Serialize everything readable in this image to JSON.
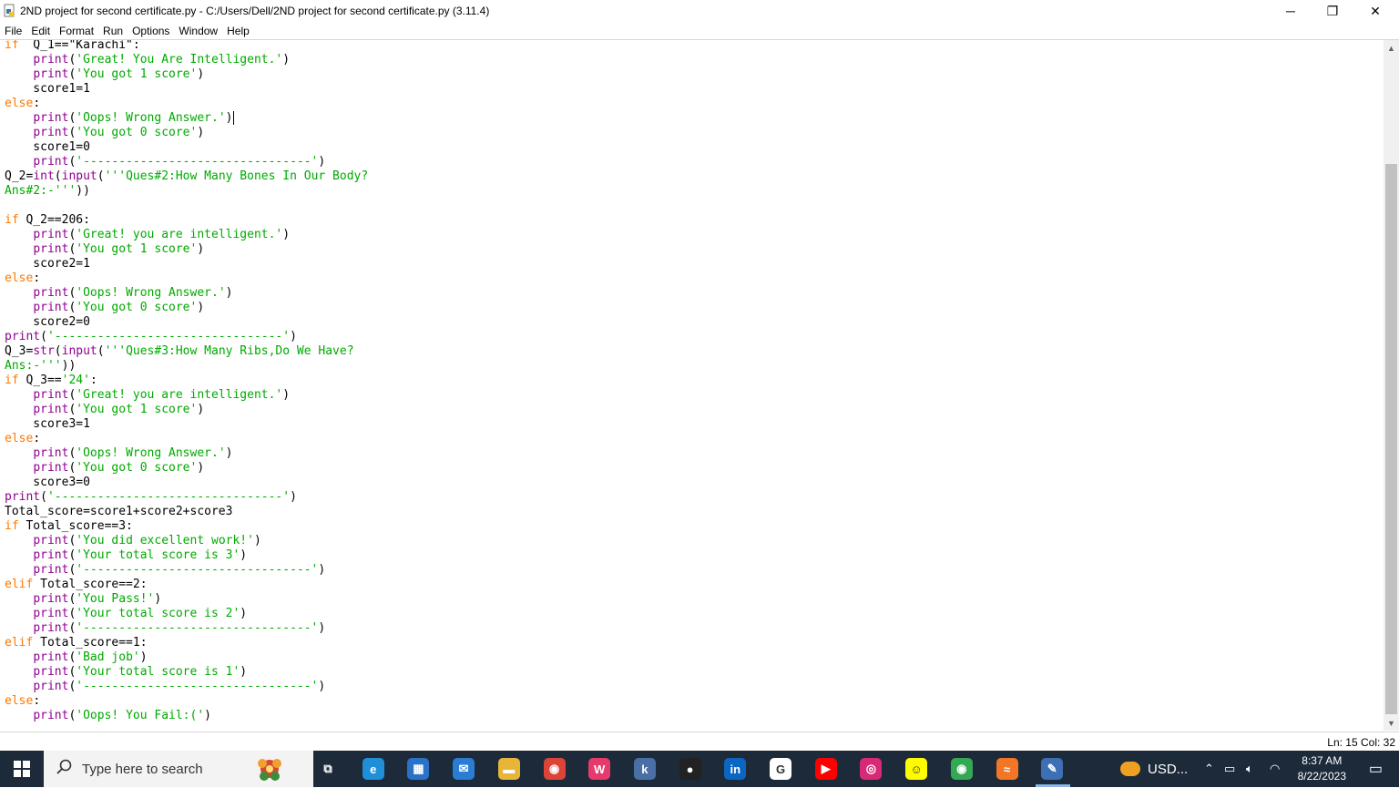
{
  "window": {
    "title": "2ND project for second certificate.py - C:/Users/Dell/2ND project for second certificate.py (3.11.4)",
    "minimize_glyph": "─",
    "restore_glyph": "❐",
    "close_glyph": "✕"
  },
  "menu": [
    "File",
    "Edit",
    "Format",
    "Run",
    "Options",
    "Window",
    "Help"
  ],
  "code_lines": [
    [
      [
        "kw",
        "if"
      ],
      [
        "",
        "  Q_1==\"Karachi\":"
      ]
    ],
    [
      [
        "",
        "    "
      ],
      [
        "bi",
        "print"
      ],
      [
        "",
        "("
      ],
      [
        "st",
        "'Great! You Are Intelligent.'"
      ],
      [
        "",
        ")"
      ]
    ],
    [
      [
        "",
        "    "
      ],
      [
        "bi",
        "print"
      ],
      [
        "",
        "("
      ],
      [
        "st",
        "'You got 1 score'"
      ],
      [
        "",
        ")"
      ]
    ],
    [
      [
        "",
        "    score1=1"
      ]
    ],
    [
      [
        "kw",
        "else"
      ],
      [
        "",
        ":"
      ]
    ],
    [
      [
        "",
        "    "
      ],
      [
        "bi",
        "print"
      ],
      [
        "",
        "("
      ],
      [
        "st",
        "'Oops! Wrong Answer.'"
      ],
      [
        "",
        ")"
      ]
    ],
    [
      [
        "",
        "    "
      ],
      [
        "bi",
        "print"
      ],
      [
        "",
        "("
      ],
      [
        "st",
        "'You got 0 score'"
      ],
      [
        "",
        ")"
      ]
    ],
    [
      [
        "",
        "    score1=0"
      ]
    ],
    [
      [
        "",
        "    "
      ],
      [
        "bi",
        "print"
      ],
      [
        "",
        "("
      ],
      [
        "st",
        "'--------------------------------'"
      ],
      [
        "",
        ")"
      ]
    ],
    [
      [
        "",
        "Q_2="
      ],
      [
        "bi",
        "int"
      ],
      [
        "",
        "("
      ],
      [
        "bi",
        "input"
      ],
      [
        "",
        "("
      ],
      [
        "st",
        "'''Ques#2:How Many Bones In Our Body?"
      ]
    ],
    [
      [
        "st",
        "Ans#2:-'''"
      ],
      [
        "",
        "))"
      ]
    ],
    [
      [
        "",
        ""
      ]
    ],
    [
      [
        "kw",
        "if"
      ],
      [
        "",
        " Q_2==206:"
      ]
    ],
    [
      [
        "",
        "    "
      ],
      [
        "bi",
        "print"
      ],
      [
        "",
        "("
      ],
      [
        "st",
        "'Great! you are intelligent.'"
      ],
      [
        "",
        ")"
      ]
    ],
    [
      [
        "",
        "    "
      ],
      [
        "bi",
        "print"
      ],
      [
        "",
        "("
      ],
      [
        "st",
        "'You got 1 score'"
      ],
      [
        "",
        ")"
      ]
    ],
    [
      [
        "",
        "    score2=1"
      ]
    ],
    [
      [
        "kw",
        "else"
      ],
      [
        "",
        ":"
      ]
    ],
    [
      [
        "",
        "    "
      ],
      [
        "bi",
        "print"
      ],
      [
        "",
        "("
      ],
      [
        "st",
        "'Oops! Wrong Answer.'"
      ],
      [
        "",
        ")"
      ]
    ],
    [
      [
        "",
        "    "
      ],
      [
        "bi",
        "print"
      ],
      [
        "",
        "("
      ],
      [
        "st",
        "'You got 0 score'"
      ],
      [
        "",
        ")"
      ]
    ],
    [
      [
        "",
        "    score2=0"
      ]
    ],
    [
      [
        "bi",
        "print"
      ],
      [
        "",
        "("
      ],
      [
        "st",
        "'--------------------------------'"
      ],
      [
        "",
        ")"
      ]
    ],
    [
      [
        "",
        "Q_3="
      ],
      [
        "bi",
        "str"
      ],
      [
        "",
        "("
      ],
      [
        "bi",
        "input"
      ],
      [
        "",
        "("
      ],
      [
        "st",
        "'''Ques#3:How Many Ribs,Do We Have?"
      ]
    ],
    [
      [
        "st",
        "Ans:-'''"
      ],
      [
        "",
        "))"
      ]
    ],
    [
      [
        "kw",
        "if"
      ],
      [
        "",
        " Q_3=="
      ],
      [
        "st",
        "'24'"
      ],
      [
        "",
        ":"
      ]
    ],
    [
      [
        "",
        "    "
      ],
      [
        "bi",
        "print"
      ],
      [
        "",
        "("
      ],
      [
        "st",
        "'Great! you are intelligent.'"
      ],
      [
        "",
        ")"
      ]
    ],
    [
      [
        "",
        "    "
      ],
      [
        "bi",
        "print"
      ],
      [
        "",
        "("
      ],
      [
        "st",
        "'You got 1 score'"
      ],
      [
        "",
        ")"
      ]
    ],
    [
      [
        "",
        "    score3=1"
      ]
    ],
    [
      [
        "kw",
        "else"
      ],
      [
        "",
        ":"
      ]
    ],
    [
      [
        "",
        "    "
      ],
      [
        "bi",
        "print"
      ],
      [
        "",
        "("
      ],
      [
        "st",
        "'Oops! Wrong Answer.'"
      ],
      [
        "",
        ")"
      ]
    ],
    [
      [
        "",
        "    "
      ],
      [
        "bi",
        "print"
      ],
      [
        "",
        "("
      ],
      [
        "st",
        "'You got 0 score'"
      ],
      [
        "",
        ")"
      ]
    ],
    [
      [
        "",
        "    score3=0"
      ]
    ],
    [
      [
        "bi",
        "print"
      ],
      [
        "",
        "("
      ],
      [
        "st",
        "'--------------------------------'"
      ],
      [
        "",
        ")"
      ]
    ],
    [
      [
        "",
        "Total_score=score1+score2+score3"
      ]
    ],
    [
      [
        "kw",
        "if"
      ],
      [
        "",
        " Total_score==3:"
      ]
    ],
    [
      [
        "",
        "    "
      ],
      [
        "bi",
        "print"
      ],
      [
        "",
        "("
      ],
      [
        "st",
        "'You did excellent work!'"
      ],
      [
        "",
        ")"
      ]
    ],
    [
      [
        "",
        "    "
      ],
      [
        "bi",
        "print"
      ],
      [
        "",
        "("
      ],
      [
        "st",
        "'Your total score is 3'"
      ],
      [
        "",
        ")"
      ]
    ],
    [
      [
        "",
        "    "
      ],
      [
        "bi",
        "print"
      ],
      [
        "",
        "("
      ],
      [
        "st",
        "'--------------------------------'"
      ],
      [
        "",
        ")"
      ]
    ],
    [
      [
        "kw",
        "elif"
      ],
      [
        "",
        " Total_score==2:"
      ]
    ],
    [
      [
        "",
        "    "
      ],
      [
        "bi",
        "print"
      ],
      [
        "",
        "("
      ],
      [
        "st",
        "'You Pass!'"
      ],
      [
        "",
        ")"
      ]
    ],
    [
      [
        "",
        "    "
      ],
      [
        "bi",
        "print"
      ],
      [
        "",
        "("
      ],
      [
        "st",
        "'Your total score is 2'"
      ],
      [
        "",
        ")"
      ]
    ],
    [
      [
        "",
        "    "
      ],
      [
        "bi",
        "print"
      ],
      [
        "",
        "("
      ],
      [
        "st",
        "'--------------------------------'"
      ],
      [
        "",
        ")"
      ]
    ],
    [
      [
        "kw",
        "elif"
      ],
      [
        "",
        " Total_score==1:"
      ]
    ],
    [
      [
        "",
        "    "
      ],
      [
        "bi",
        "print"
      ],
      [
        "",
        "("
      ],
      [
        "st",
        "'Bad job'"
      ],
      [
        "",
        ")"
      ]
    ],
    [
      [
        "",
        "    "
      ],
      [
        "bi",
        "print"
      ],
      [
        "",
        "("
      ],
      [
        "st",
        "'Your total score is 1'"
      ],
      [
        "",
        ")"
      ]
    ],
    [
      [
        "",
        "    "
      ],
      [
        "bi",
        "print"
      ],
      [
        "",
        "("
      ],
      [
        "st",
        "'--------------------------------'"
      ],
      [
        "",
        ")"
      ]
    ],
    [
      [
        "kw",
        "else"
      ],
      [
        "",
        ":"
      ]
    ],
    [
      [
        "",
        "    "
      ],
      [
        "bi",
        "print"
      ],
      [
        "",
        "("
      ],
      [
        "st",
        "'Oops! You Fail:('"
      ],
      [
        "",
        ")"
      ]
    ]
  ],
  "cursor": {
    "line": 15,
    "col": 32
  },
  "status": {
    "position": "Ln: 15   Col: 32"
  },
  "taskbar": {
    "search_placeholder": "Type here to search",
    "tray_weather": "USD...",
    "clock_time": "8:37 AM",
    "clock_date": "8/22/2023",
    "apps": [
      {
        "name": "task-view-icon",
        "glyph": "⧉",
        "bg": "transparent"
      },
      {
        "name": "edge-icon",
        "glyph": "e",
        "bg": "#1f8fd8"
      },
      {
        "name": "store-icon",
        "glyph": "▦",
        "bg": "#2a72c8"
      },
      {
        "name": "mail-icon",
        "glyph": "✉",
        "bg": "#2b7cd3"
      },
      {
        "name": "file-explorer-icon",
        "glyph": "▬",
        "bg": "#e7b537"
      },
      {
        "name": "chrome-icon",
        "glyph": "◉",
        "bg": "#db4437"
      },
      {
        "name": "wps-icon",
        "glyph": "W",
        "bg": "#e53a6b"
      },
      {
        "name": "k-app-icon",
        "glyph": "k",
        "bg": "#4a6fa5"
      },
      {
        "name": "github-icon",
        "glyph": "●",
        "bg": "#222222"
      },
      {
        "name": "linkedin-icon",
        "glyph": "in",
        "bg": "#0a66c2"
      },
      {
        "name": "google-icon",
        "glyph": "G",
        "bg": "#ffffff"
      },
      {
        "name": "youtube-icon",
        "glyph": "▶",
        "bg": "#ff0000"
      },
      {
        "name": "instagram-icon",
        "glyph": "◎",
        "bg": "#d62976"
      },
      {
        "name": "snapchat-icon",
        "glyph": "☺",
        "bg": "#fffc00"
      },
      {
        "name": "chrome-profile-icon",
        "glyph": "◉",
        "bg": "#34a853"
      },
      {
        "name": "jupyter-icon",
        "glyph": "≈",
        "bg": "#f37626"
      },
      {
        "name": "idle-icon",
        "glyph": "✎",
        "bg": "#3d6fb5"
      }
    ]
  }
}
